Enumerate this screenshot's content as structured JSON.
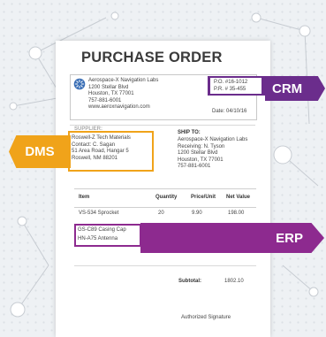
{
  "po": {
    "title": "PURCHASE ORDER",
    "vendor": {
      "name": "Aerospace-X Navigation Labs",
      "address1": "1200 Stellar Blvd",
      "address2": "Houston, TX 77001",
      "phone": "757-881-6001",
      "web": "www.aeroxnavigation.com"
    },
    "po_number": "P.O. #16-1012",
    "pr_number": "P.R. # 35-455",
    "date": "Date: 04/10/16",
    "supplier": {
      "heading": "SUPPLIER:",
      "name": "Roswell-Z Tech Materials",
      "contact": "Contact: C. Sagan",
      "address1": "51 Area Road, Hangar 5",
      "address2": "Roswell, NM 88201"
    },
    "ship_to": {
      "heading": "SHIP TO:",
      "name": "Aerospace-X Navigation Labs",
      "receiving": "Receiving: N. Tyson",
      "address1": "1200 Stellar Blvd",
      "address2": "Houston, TX 77001",
      "phone": "757-881-6001"
    },
    "table": {
      "headers": [
        "Item",
        "Quantity",
        "Price/Unit",
        "Net Value"
      ],
      "rows": [
        {
          "item": "VS-534 Sprocket",
          "qty": "20",
          "price": "9.90",
          "net": "198.00"
        },
        {
          "item": "GS-C89 Casing Cap",
          "qty": "",
          "price": "",
          "net": ""
        },
        {
          "item": "HN-A75 Antenna",
          "qty": "",
          "price": "",
          "net": ""
        }
      ]
    },
    "subtotal_label": "Subtotal:",
    "subtotal_value": "1802.10",
    "signature": "Authorized Signature"
  },
  "tags": {
    "crm": "CRM",
    "dms": "DMS",
    "erp": "ERP"
  },
  "colors": {
    "crm": "#6b2d8c",
    "dms": "#f0a31a",
    "erp": "#8d2a8f",
    "logo": "#3b6fb6"
  },
  "icons": {
    "logo": "starburst-logo-icon"
  }
}
